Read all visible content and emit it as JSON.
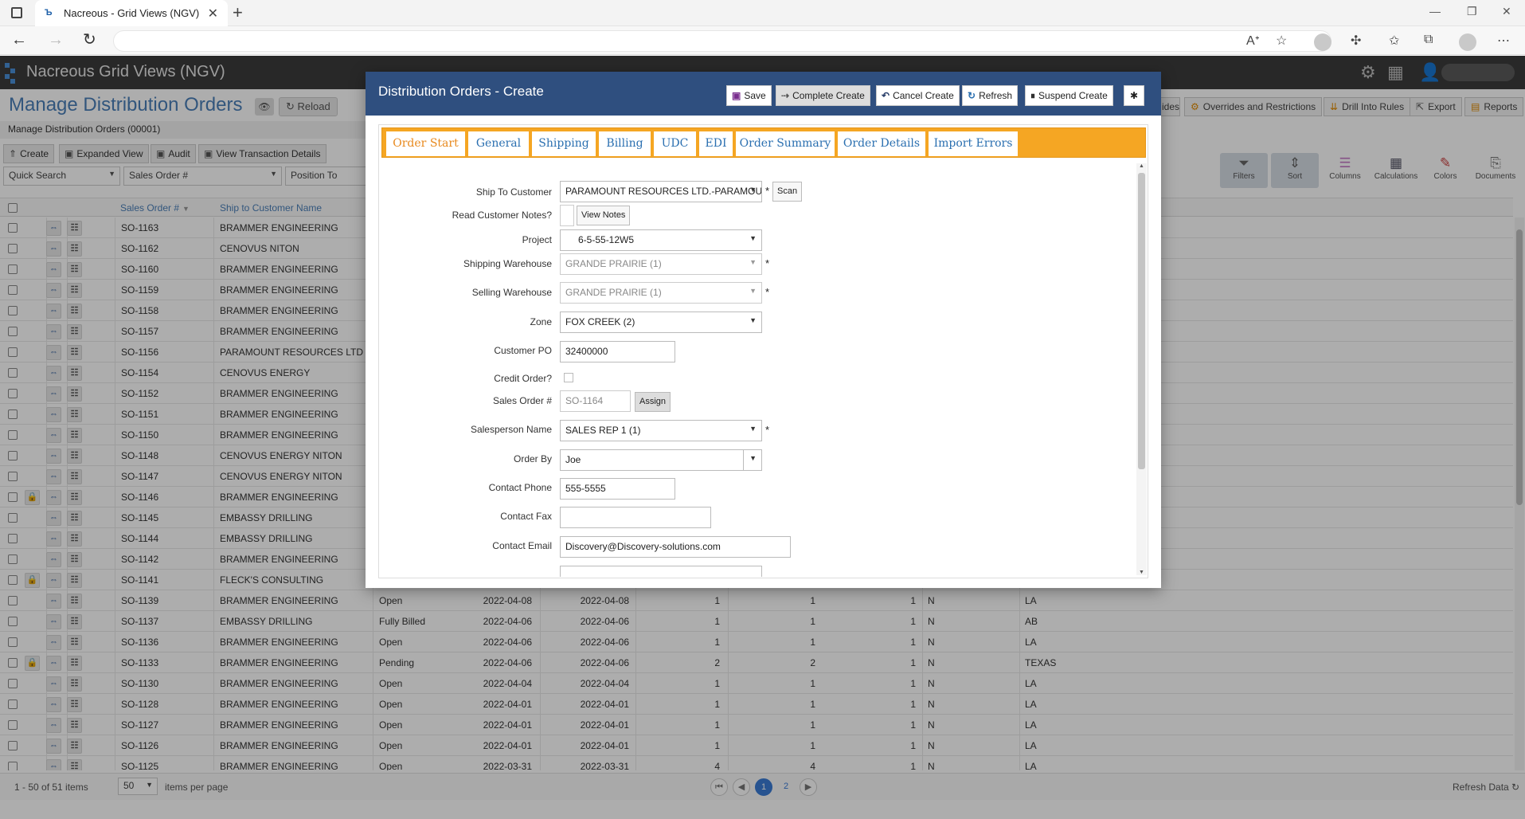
{
  "browser": {
    "tab_title": "Nacreous - Grid Views (NGV)",
    "tab_close": "✕",
    "new_tab": "+",
    "minimize": "—",
    "restore": "❐",
    "close": "✕"
  },
  "app": {
    "title": "Nacreous Grid Views (NGV)"
  },
  "page": {
    "title": "Manage Distribution Orders",
    "reload": "Reload",
    "subtitle": "Manage Distribution Orders (00001)",
    "right_buttons": [
      "ides",
      "Overrides and Restrictions",
      "Drill Into Rules",
      "Export",
      "Reports"
    ]
  },
  "toolbar": {
    "create": "Create",
    "expanded_view": "Expanded View",
    "audit": "Audit",
    "view_transaction_details": "View Transaction Details"
  },
  "quick_search": {
    "quick_search": "Quick Search",
    "sales_order": "Sales Order #",
    "position_to": "Position To"
  },
  "grid_tools": [
    "Filters",
    "Sort",
    "Columns",
    "Calculations",
    "Colors",
    "Documents"
  ],
  "grid": {
    "headers": {
      "sales_order": "Sales Order #",
      "ship_to": "Ship to Customer Name"
    },
    "rows": [
      {
        "so": "SO-1163",
        "name": "BRAMMER ENGINEERING",
        "locked": false
      },
      {
        "so": "SO-1162",
        "name": "CENOVUS NITON",
        "locked": false
      },
      {
        "so": "SO-1160",
        "name": "BRAMMER ENGINEERING",
        "locked": false
      },
      {
        "so": "SO-1159",
        "name": "BRAMMER ENGINEERING",
        "locked": false
      },
      {
        "so": "SO-1158",
        "name": "BRAMMER ENGINEERING",
        "locked": false
      },
      {
        "so": "SO-1157",
        "name": "BRAMMER ENGINEERING",
        "locked": false
      },
      {
        "so": "SO-1156",
        "name": "PARAMOUNT RESOURCES LTD",
        "locked": false
      },
      {
        "so": "SO-1154",
        "name": "CENOVUS ENERGY",
        "locked": false
      },
      {
        "so": "SO-1152",
        "name": "BRAMMER ENGINEERING",
        "locked": false
      },
      {
        "so": "SO-1151",
        "name": "BRAMMER ENGINEERING",
        "locked": false
      },
      {
        "so": "SO-1150",
        "name": "BRAMMER ENGINEERING",
        "locked": false
      },
      {
        "so": "SO-1148",
        "name": "CENOVUS ENERGY NITON",
        "locked": false
      },
      {
        "so": "SO-1147",
        "name": "CENOVUS ENERGY NITON",
        "locked": false
      },
      {
        "so": "SO-1146",
        "name": "BRAMMER ENGINEERING",
        "locked": true
      },
      {
        "so": "SO-1145",
        "name": "EMBASSY DRILLING",
        "locked": false
      },
      {
        "so": "SO-1144",
        "name": "EMBASSY DRILLING",
        "locked": false
      },
      {
        "so": "SO-1142",
        "name": "BRAMMER ENGINEERING",
        "locked": false
      },
      {
        "so": "SO-1141",
        "name": "FLECK'S CONSULTING",
        "locked": true
      },
      {
        "so": "SO-1139",
        "name": "BRAMMER ENGINEERING",
        "locked": false,
        "status": "Open",
        "d1": "2022-04-08",
        "d2": "2022-04-08",
        "n1": "1",
        "n2": "1",
        "n3": "1",
        "flag": "N",
        "region": "LA"
      },
      {
        "so": "SO-1137",
        "name": "EMBASSY DRILLING",
        "locked": false,
        "status": "Fully Billed",
        "d1": "2022-04-06",
        "d2": "2022-04-06",
        "n1": "1",
        "n2": "1",
        "n3": "1",
        "flag": "N",
        "region": "AB"
      },
      {
        "so": "SO-1136",
        "name": "BRAMMER ENGINEERING",
        "locked": false,
        "status": "Open",
        "d1": "2022-04-06",
        "d2": "2022-04-06",
        "n1": "1",
        "n2": "1",
        "n3": "1",
        "flag": "N",
        "region": "LA"
      },
      {
        "so": "SO-1133",
        "name": "BRAMMER ENGINEERING",
        "locked": true,
        "status": "Pending",
        "d1": "2022-04-06",
        "d2": "2022-04-06",
        "n1": "2",
        "n2": "2",
        "n3": "1",
        "flag": "N",
        "region": "TEXAS"
      },
      {
        "so": "SO-1130",
        "name": "BRAMMER ENGINEERING",
        "locked": false,
        "status": "Open",
        "d1": "2022-04-04",
        "d2": "2022-04-04",
        "n1": "1",
        "n2": "1",
        "n3": "1",
        "flag": "N",
        "region": "LA"
      },
      {
        "so": "SO-1128",
        "name": "BRAMMER ENGINEERING",
        "locked": false,
        "status": "Open",
        "d1": "2022-04-01",
        "d2": "2022-04-01",
        "n1": "1",
        "n2": "1",
        "n3": "1",
        "flag": "N",
        "region": "LA"
      },
      {
        "so": "SO-1127",
        "name": "BRAMMER ENGINEERING",
        "locked": false,
        "status": "Open",
        "d1": "2022-04-01",
        "d2": "2022-04-01",
        "n1": "1",
        "n2": "1",
        "n3": "1",
        "flag": "N",
        "region": "LA"
      },
      {
        "so": "SO-1126",
        "name": "BRAMMER ENGINEERING",
        "locked": false,
        "status": "Open",
        "d1": "2022-04-01",
        "d2": "2022-04-01",
        "n1": "1",
        "n2": "1",
        "n3": "1",
        "flag": "N",
        "region": "LA"
      },
      {
        "so": "SO-1125",
        "name": "BRAMMER ENGINEERING",
        "locked": false,
        "status": "Open",
        "d1": "2022-03-31",
        "d2": "2022-03-31",
        "n1": "4",
        "n2": "4",
        "n3": "1",
        "flag": "N",
        "region": "LA"
      }
    ]
  },
  "footer": {
    "items": "1 - 50 of 51 items",
    "per_page": "50",
    "per_page_label": "items per page",
    "pages": [
      "1",
      "2"
    ],
    "refresh": "Refresh Data"
  },
  "dialog": {
    "title": "Distribution Orders - Create",
    "buttons": {
      "save": "Save",
      "complete_create": "Complete Create",
      "cancel_create": "Cancel Create",
      "refresh": "Refresh",
      "suspend_create": "Suspend Create"
    },
    "tabs": [
      "Order Start",
      "General",
      "Shipping",
      "Billing",
      "UDC",
      "EDI",
      "Order Summary",
      "Order Details",
      "Import Errors"
    ],
    "form": {
      "ship_to_customer": {
        "label": "Ship To Customer",
        "value": "PARAMOUNT RESOURCES LTD.-PARAMOUNT RE...",
        "scan": "Scan"
      },
      "read_notes": {
        "label": "Read Customer Notes?",
        "button": "View Notes"
      },
      "project": {
        "label": "Project",
        "value": "6-5-55-12W5"
      },
      "shipping_warehouse": {
        "label": "Shipping Warehouse",
        "value": "GRANDE PRAIRIE (1)"
      },
      "selling_warehouse": {
        "label": "Selling Warehouse",
        "value": "GRANDE PRAIRIE (1)"
      },
      "zone": {
        "label": "Zone",
        "value": "FOX CREEK (2)"
      },
      "customer_po": {
        "label": "Customer PO",
        "value": "32400000"
      },
      "credit_order": {
        "label": "Credit Order?"
      },
      "sales_order": {
        "label": "Sales Order #",
        "value": "SO-1164",
        "assign": "Assign"
      },
      "salesperson": {
        "label": "Salesperson Name",
        "value": "SALES REP 1 (1)"
      },
      "order_by": {
        "label": "Order By",
        "value": "Joe"
      },
      "contact_phone": {
        "label": "Contact Phone",
        "value": "555-5555"
      },
      "contact_fax": {
        "label": "Contact Fax",
        "value": ""
      },
      "contact_email": {
        "label": "Contact Email",
        "value": "Discovery@Discovery-solutions.com"
      }
    },
    "required_marker": "*"
  }
}
